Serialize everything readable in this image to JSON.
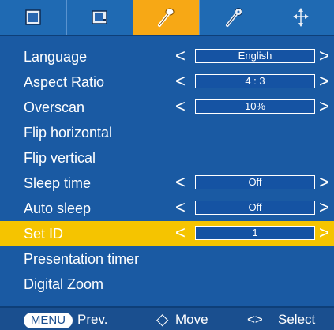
{
  "tabs": [
    {
      "icon": "picture-icon"
    },
    {
      "icon": "screen-icon"
    },
    {
      "icon": "setup-icon",
      "active": true
    },
    {
      "icon": "option-icon"
    },
    {
      "icon": "network-icon"
    }
  ],
  "menu": {
    "items": [
      {
        "label": "Language",
        "value": "English",
        "selected": false
      },
      {
        "label": "Aspect Ratio",
        "value": "4 : 3",
        "selected": false
      },
      {
        "label": "Overscan",
        "value": "10%",
        "selected": false
      },
      {
        "label": "Flip horizontal"
      },
      {
        "label": "Flip vertical"
      },
      {
        "label": "Sleep time",
        "value": "Off",
        "selected": false
      },
      {
        "label": "Auto sleep",
        "value": "Off",
        "selected": false
      },
      {
        "label": "Set ID",
        "value": "1",
        "selected": true
      },
      {
        "label": "Presentation timer"
      },
      {
        "label": "Digital Zoom"
      }
    ],
    "arrow_left": "<",
    "arrow_right": ">"
  },
  "footer": {
    "menu_button": "MENU",
    "prev": "Prev.",
    "move_icon": "◇",
    "move": "Move",
    "select_arrows": "<>",
    "select": "Select"
  },
  "colors": {
    "background": "#1a5aa3",
    "active_tab": "#f7a815",
    "selected_row": "#f5c400"
  }
}
